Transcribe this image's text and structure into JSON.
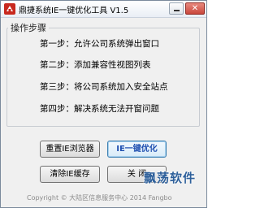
{
  "window": {
    "title": "鼎捷系统IE一键优化工具 V1.5",
    "close_symbol": "✕"
  },
  "group": {
    "title": "操作步骤",
    "steps": [
      "第一步：允许公司系统弹出窗口",
      "第二步：添加兼容性视图列表",
      "第三步：将公司系统加入安全站点",
      "第四步：解决系统无法开窗问题"
    ]
  },
  "buttons": {
    "reset_ie": "重置IE浏览器",
    "ie_optimize": "IE一键优化",
    "clear_cache": "清除IE缓存",
    "close": "关 闭"
  },
  "footer": {
    "copyright": "Copyright © 大陆区信息服务中心 2014 Fangbo"
  },
  "watermark": "飘荡软件",
  "colors": {
    "accent_blue": "#1f4fb0",
    "icon_red": "#c8281e",
    "close_button_red": "#c9483c"
  }
}
